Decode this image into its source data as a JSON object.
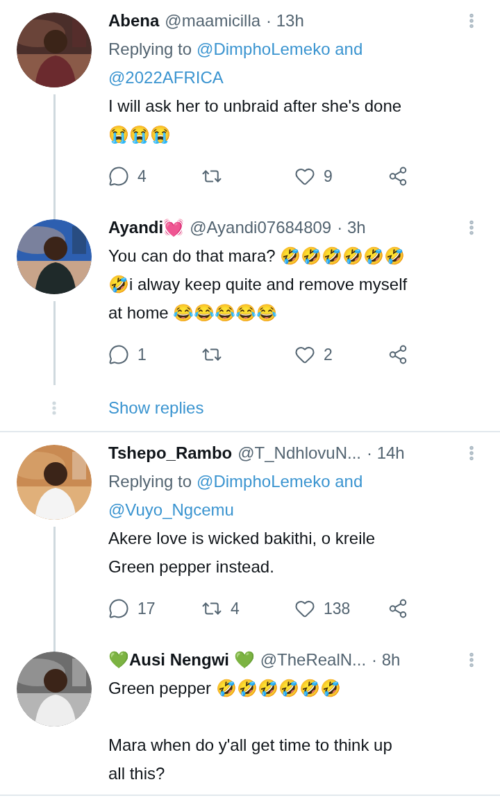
{
  "threads": [
    {
      "tweets": [
        {
          "name": "Abena",
          "handle": "@maamicilla",
          "time": "· 13h",
          "replying_prefix": "Replying to",
          "replying_lines": [
            "@DimphoLemeko and",
            "@2022AFRICA"
          ],
          "paragraphs": [
            [
              "I will ask her to unbraid after she's done",
              "😭😭😭"
            ]
          ],
          "replies": "4",
          "likes": "9"
        },
        {
          "name": "Ayandi💓",
          "handle": "@Ayandi07684809",
          "time": "· 3h",
          "paragraphs": [
            [
              "You can do that mara? 🤣🤣🤣🤣🤣🤣",
              "🤣i alway keep quite and remove myself",
              "at home 😂😂😂😂😂"
            ]
          ],
          "replies": "1",
          "likes": "2"
        }
      ],
      "show_replies": "Show replies"
    },
    {
      "tweets": [
        {
          "name": "Tshepo_Rambo",
          "handle": "@T_NdhlovuN...",
          "time": "· 14h",
          "replying_prefix": "Replying to",
          "replying_lines": [
            "@DimphoLemeko and",
            "@Vuyo_Ngcemu"
          ],
          "paragraphs": [
            [
              "Akere love is wicked bakithi, o kreile",
              "Green pepper instead."
            ]
          ],
          "replies": "17",
          "retweets": "4",
          "likes": "138"
        },
        {
          "name": "💚Ausi Nengwi 💚",
          "handle": "@TheRealN...",
          "time": "· 8h",
          "paragraphs": [
            [
              "Green pepper 🤣🤣🤣🤣🤣🤣"
            ],
            [
              "Mara when do y'all get time to think up",
              "all this?"
            ]
          ]
        }
      ]
    }
  ]
}
